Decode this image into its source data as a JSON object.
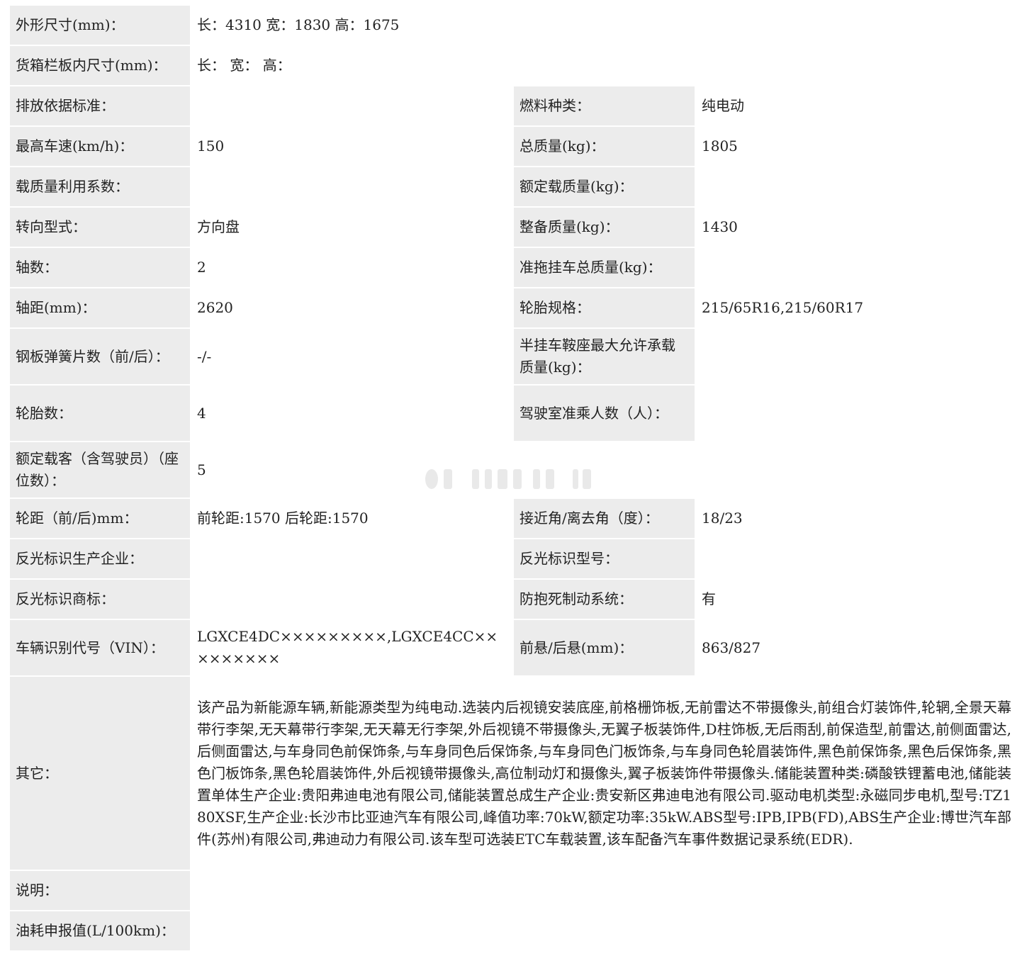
{
  "spec": {
    "dims_label": "外形尺寸(mm)：",
    "dims_value": "长：4310 宽：1830 高：1675",
    "cargo_label": "货箱栏板内尺寸(mm)：",
    "cargo_value": "长： 宽： 高：",
    "emission_label": "排放依据标准：",
    "emission_value": "",
    "fuel_label": "燃料种类：",
    "fuel_value": "纯电动",
    "speed_label": "最高车速(km/h)：",
    "speed_value": "150",
    "total_mass_label": "总质量(kg)：",
    "total_mass_value": "1805",
    "load_util_label": "载质量利用系数：",
    "load_util_value": "",
    "rated_load_label": "额定载质量(kg)：",
    "rated_load_value": "",
    "steering_label": "转向型式：",
    "steering_value": "方向盘",
    "curb_label": "整备质量(kg)：",
    "curb_value": "1430",
    "axles_label": "轴数：",
    "axles_value": "2",
    "trailer_label": "准拖挂车总质量(kg)：",
    "trailer_value": "",
    "wheelbase_label": "轴距(mm)：",
    "wheelbase_value": "2620",
    "tire_spec_label": "轮胎规格：",
    "tire_spec_value": "215/65R16,215/60R17",
    "spring_label": "钢板弹簧片数（前/后）：",
    "spring_value": "-/-",
    "saddle_label": "半挂车鞍座最大允许承载质量(kg)：",
    "saddle_value": "",
    "tires_label": "轮胎数：",
    "tires_value": "4",
    "cab_label": "驾驶室准乘人数（人）：",
    "cab_value": "",
    "pass_label": "额定载客（含驾驶员）（座位数）：",
    "pass_value": "5",
    "track_label": "轮距（前/后)mm：",
    "track_value": "前轮距:1570 后轮距:1570",
    "angle_label": "接近角/离去角（度）：",
    "angle_value": "18/23",
    "refl_maker_label": "反光标识生产企业：",
    "refl_maker_value": "",
    "refl_model_label": "反光标识型号：",
    "refl_model_value": "",
    "refl_brand_label": "反光标识商标：",
    "refl_brand_value": "",
    "abs_label": "防抱死制动系统：",
    "abs_value": "有",
    "vin_label": "车辆识别代号（VIN）：",
    "vin_value": "LGXCE4DC×××××××××,LGXCE4CC×××××××××",
    "overhang_label": "前悬/后悬(mm)：",
    "overhang_value": "863/827",
    "other_label": "其它：",
    "other_value": "该产品为新能源车辆,新能源类型为纯电动.选装内后视镜安装底座,前格栅饰板,无前雷达不带摄像头,前组合灯装饰件,轮辋,全景天幕带行李架,无天幕带行李架,无天幕无行李架,外后视镜不带摄像头,无翼子板装饰件,D柱饰板,无后雨刮,前保造型,前雷达,前侧面雷达,后侧面雷达,与车身同色前保饰条,与车身同色后保饰条,与车身同色门板饰条,与车身同色轮眉装饰件,黑色前保饰条,黑色后保饰条,黑色门板饰条,黑色轮眉装饰件,外后视镜带摄像头,高位制动灯和摄像头,翼子板装饰件带摄像头.储能装置种类:磷酸铁锂蓄电池,储能装置单体生产企业:贵阳弗迪电池有限公司,储能装置总成生产企业:贵安新区弗迪电池有限公司.驱动电机类型:永磁同步电机,型号:TZ180XSF,生产企业:长沙市比亚迪汽车有限公司,峰值功率:70kW,额定功率:35kW.ABS型号:IPB,IPB(FD),ABS生产企业:博世汽车部件(苏州)有限公司,弗迪动力有限公司.该车型可选装ETC车载装置,该车配备汽车事件数据记录系统(EDR).",
    "note_label": "说明：",
    "note_value": "",
    "fuel_cons_label": "油耗申报值(L/100km)：",
    "fuel_cons_value": ""
  }
}
